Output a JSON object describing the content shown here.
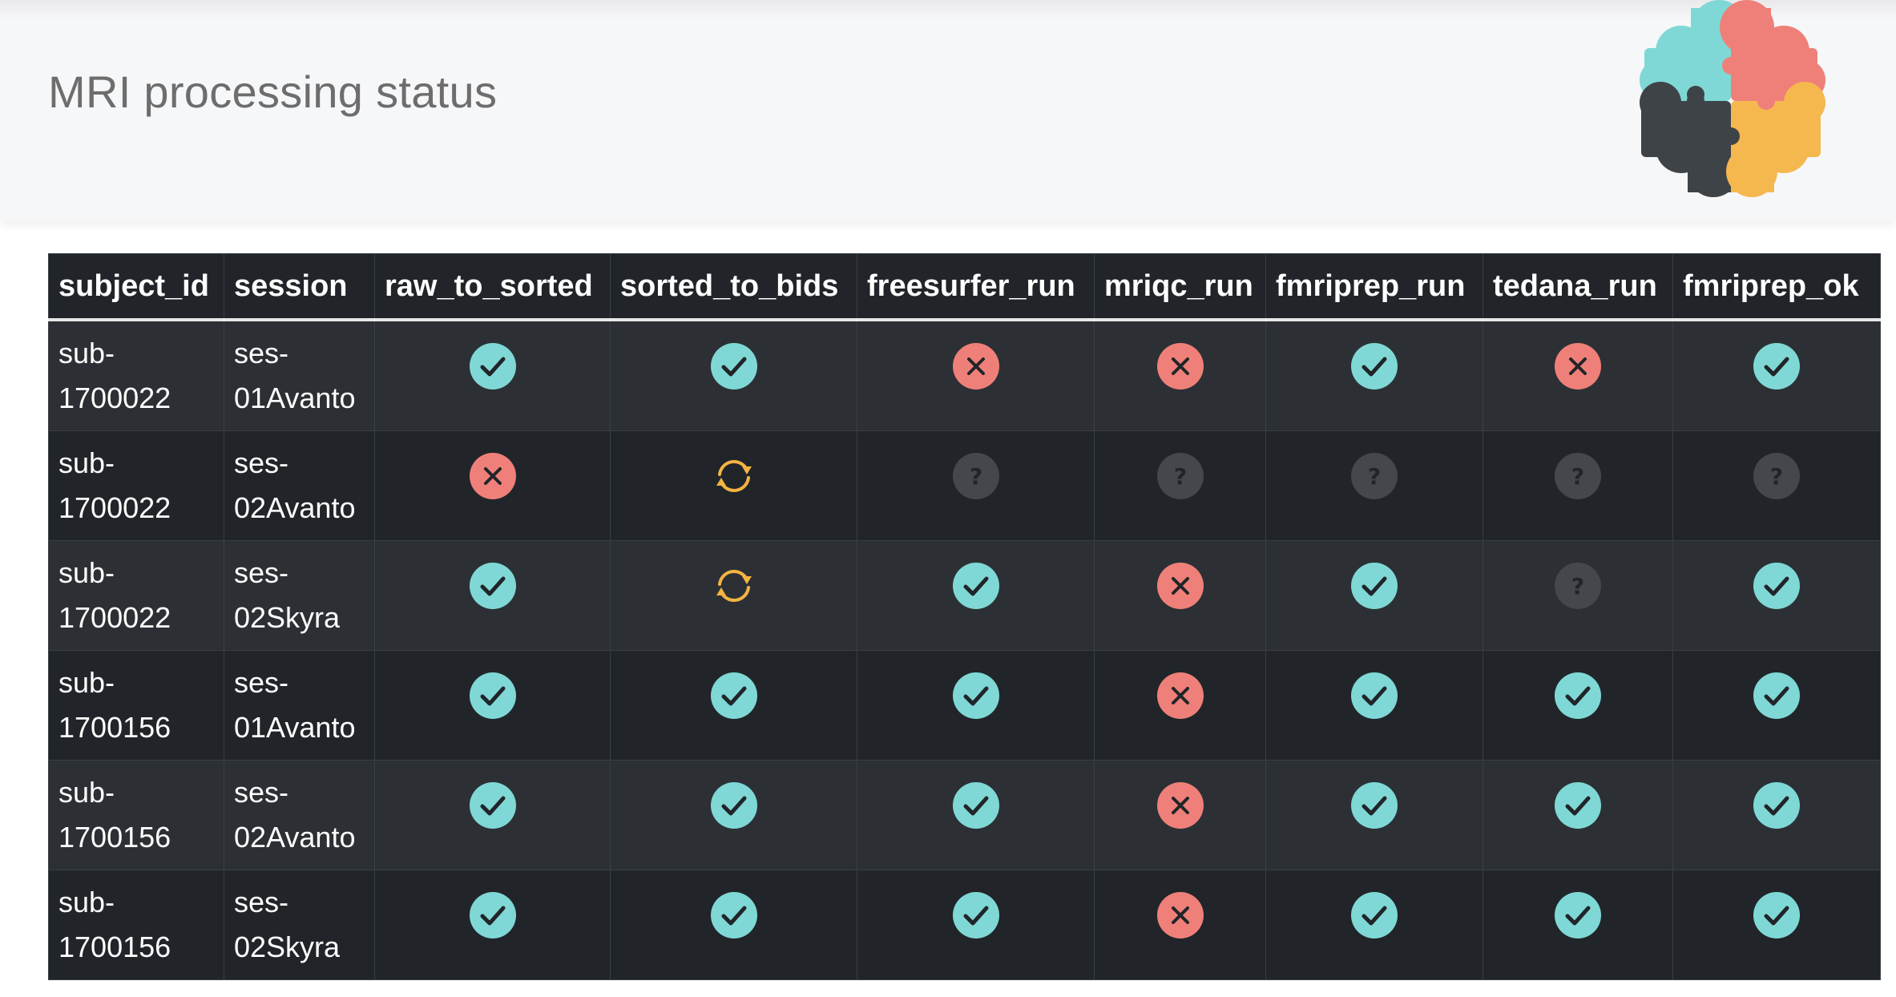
{
  "header": {
    "title": "MRI processing status",
    "logo_icon": "brain-puzzle-logo"
  },
  "colors": {
    "ok": "#7fd8d6",
    "fail": "#ef8079",
    "running": "#f5b342",
    "unknown": "#44484d",
    "header_bg": "#f6f7f9",
    "table_dark": "#212529",
    "table_stripe": "#2c3034"
  },
  "status_legend": {
    "ok": "check-circle-icon",
    "fail": "x-circle-icon",
    "running": "sync-arrows-icon",
    "unknown": "question-circle-icon"
  },
  "table": {
    "columns": [
      "subject_id",
      "session",
      "raw_to_sorted",
      "sorted_to_bids",
      "freesurfer_run",
      "mriqc_run",
      "fmriprep_run",
      "tedana_run",
      "fmriprep_ok"
    ],
    "rows": [
      {
        "subject_id": [
          "sub-",
          "1700022"
        ],
        "session": [
          "ses-",
          "01Avanto"
        ],
        "statuses": [
          "ok",
          "ok",
          "fail",
          "fail",
          "ok",
          "fail",
          "ok"
        ]
      },
      {
        "subject_id": [
          "sub-",
          "1700022"
        ],
        "session": [
          "ses-",
          "02Avanto"
        ],
        "statuses": [
          "fail",
          "running",
          "unknown",
          "unknown",
          "unknown",
          "unknown",
          "unknown"
        ]
      },
      {
        "subject_id": [
          "sub-",
          "1700022"
        ],
        "session": [
          "ses-",
          "02Skyra"
        ],
        "statuses": [
          "ok",
          "running",
          "ok",
          "fail",
          "ok",
          "unknown",
          "ok"
        ]
      },
      {
        "subject_id": [
          "sub-",
          "1700156"
        ],
        "session": [
          "ses-",
          "01Avanto"
        ],
        "statuses": [
          "ok",
          "ok",
          "ok",
          "fail",
          "ok",
          "ok",
          "ok"
        ]
      },
      {
        "subject_id": [
          "sub-",
          "1700156"
        ],
        "session": [
          "ses-",
          "02Avanto"
        ],
        "statuses": [
          "ok",
          "ok",
          "ok",
          "fail",
          "ok",
          "ok",
          "ok"
        ]
      },
      {
        "subject_id": [
          "sub-",
          "1700156"
        ],
        "session": [
          "ses-",
          "02Skyra"
        ],
        "statuses": [
          "ok",
          "ok",
          "ok",
          "fail",
          "ok",
          "ok",
          "ok"
        ]
      }
    ]
  }
}
